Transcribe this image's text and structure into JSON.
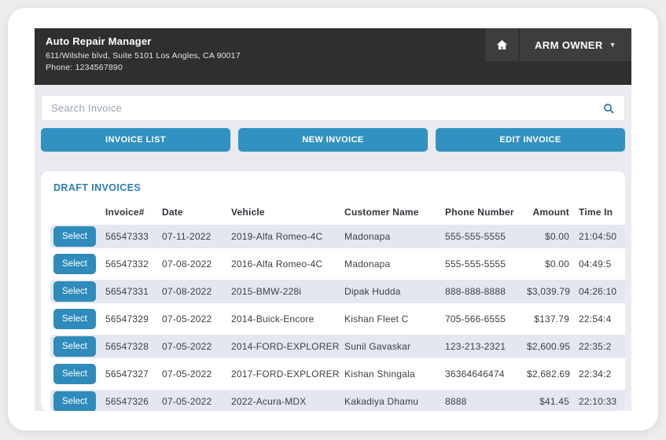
{
  "header": {
    "title": "Auto Repair Manager",
    "address": "611/Wilshie blvd, Suite 5101 Los Angles, CA 90017",
    "phone": "Phone: 1234567890",
    "user_label": "ARM OWNER",
    "caret": "▼"
  },
  "search": {
    "placeholder": "Search Invoice"
  },
  "nav_buttons": {
    "invoice_list": "INVOICE LIST",
    "new_invoice": "NEW INVOICE",
    "edit_invoice": "EDIT INVOICE"
  },
  "table": {
    "title": "DRAFT INVOICES",
    "select_label": "Select",
    "columns": [
      "",
      "Invoice#",
      "Date",
      "Vehicle",
      "Customer Name",
      "Phone Number",
      "Amount",
      "Time In"
    ],
    "rows": [
      {
        "invoice": "56547333",
        "date": "07-11-2022",
        "vehicle": "2019-Alfa Romeo-4C",
        "customer": "Madonapa",
        "phone": "555-555-5555",
        "amount": "$0.00",
        "time": "21:04:50"
      },
      {
        "invoice": "56547332",
        "date": "07-08-2022",
        "vehicle": "2016-Alfa Romeo-4C",
        "customer": "Madonapa",
        "phone": "555-555-5555",
        "amount": "$0.00",
        "time": "04:49:5"
      },
      {
        "invoice": "56547331",
        "date": "07-08-2022",
        "vehicle": "2015-BMW-228i",
        "customer": "Dipak Hudda",
        "phone": "888-888-8888",
        "amount": "$3,039.79",
        "time": "04:26:10"
      },
      {
        "invoice": "56547329",
        "date": "07-05-2022",
        "vehicle": "2014-Buick-Encore",
        "customer": "Kishan Fleet C",
        "phone": "705-566-6555",
        "amount": "$137.79",
        "time": "22:54:4"
      },
      {
        "invoice": "56547328",
        "date": "07-05-2022",
        "vehicle": "2014-FORD-EXPLORER",
        "customer": "Sunil Gavaskar",
        "phone": "123-213-2321",
        "amount": "$2,600.95",
        "time": "22:35:2"
      },
      {
        "invoice": "56547327",
        "date": "07-05-2022",
        "vehicle": "2017-FORD-EXPLORER",
        "customer": "Kishan Shingala",
        "phone": "36364646474",
        "amount": "$2,682.69",
        "time": "22:34:2"
      },
      {
        "invoice": "56547326",
        "date": "07-05-2022",
        "vehicle": "2022-Acura-MDX",
        "customer": "Kakadiya Dhamu",
        "phone": "8888",
        "amount": "$41.45",
        "time": "22:10:33"
      }
    ]
  },
  "colors": {
    "accent_blue": "#3191c0",
    "select_blue": "#2e8bbb",
    "title_blue": "#2a7fc0",
    "header_dark": "#2f2f2f",
    "header_block": "#3d3d3d",
    "row_stripe": "#e4e7ef",
    "content_bg": "#e9ebf0"
  }
}
